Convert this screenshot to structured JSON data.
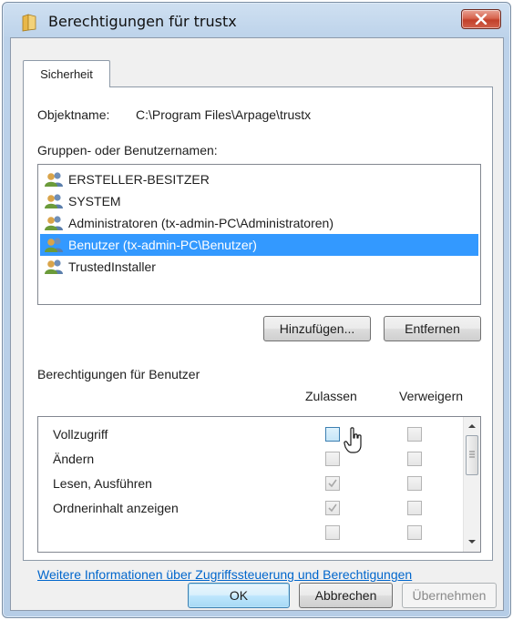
{
  "window": {
    "title": "Berechtigungen für trustx"
  },
  "tabs": [
    {
      "label": "Sicherheit"
    }
  ],
  "object": {
    "label": "Objektname:",
    "value": "C:\\Program Files\\Arpage\\trustx"
  },
  "groups": {
    "label": "Gruppen- oder Benutzernamen:",
    "items": [
      {
        "label": "ERSTELLER-BESITZER"
      },
      {
        "label": "SYSTEM"
      },
      {
        "label": "Administratoren (tx-admin-PC\\Administratoren)"
      },
      {
        "label": "Benutzer (tx-admin-PC\\Benutzer)",
        "selected": true
      },
      {
        "label": "TrustedInstaller"
      }
    ]
  },
  "buttons": {
    "add": "Hinzufügen...",
    "remove": "Entfernen",
    "ok": "OK",
    "cancel": "Abbrechen",
    "apply": "Übernehmen"
  },
  "permissions": {
    "header": "Berechtigungen für Benutzer",
    "col_allow": "Zulassen",
    "col_deny": "Verweigern",
    "rows": [
      {
        "label": "Vollzugriff",
        "allow": false,
        "deny": false
      },
      {
        "label": "Ändern",
        "allow": false,
        "deny": false
      },
      {
        "label": "Lesen, Ausführen",
        "allow": true,
        "deny": false
      },
      {
        "label": "Ordnerinhalt anzeigen",
        "allow": true,
        "deny": false
      }
    ]
  },
  "link": {
    "text": "Weitere Informationen über Zugriffssteuerung und Berechtigungen"
  },
  "colors": {
    "selection": "#3399ff",
    "link": "#0066cc",
    "close": "#c7452e"
  }
}
